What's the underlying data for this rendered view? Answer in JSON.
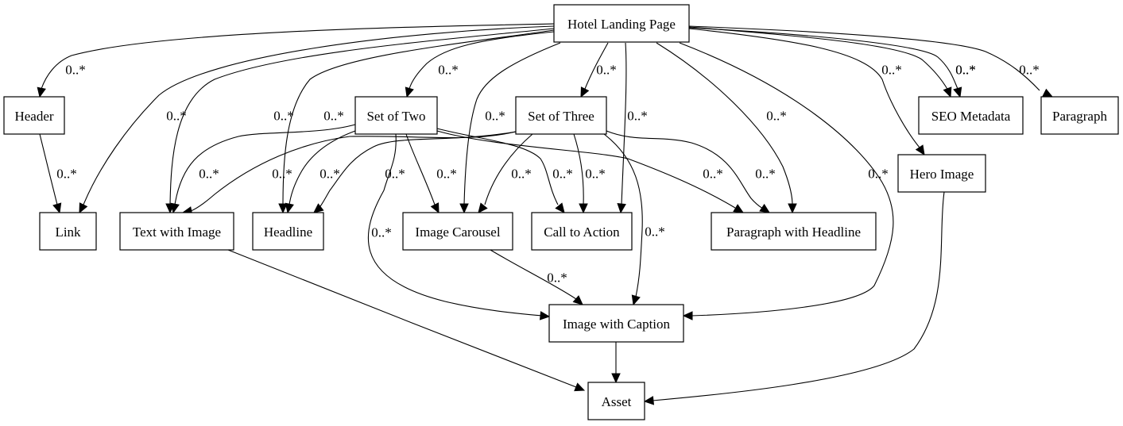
{
  "diagram": {
    "type": "uml-composition-graph",
    "nodes": [
      {
        "id": "hotel",
        "label": "Hotel Landing Page"
      },
      {
        "id": "header",
        "label": "Header"
      },
      {
        "id": "set2",
        "label": "Set of Two"
      },
      {
        "id": "set3",
        "label": "Set of Three"
      },
      {
        "id": "seo",
        "label": "SEO Metadata"
      },
      {
        "id": "paragraph",
        "label": "Paragraph"
      },
      {
        "id": "hero",
        "label": "Hero Image"
      },
      {
        "id": "link",
        "label": "Link"
      },
      {
        "id": "twi",
        "label": "Text with Image"
      },
      {
        "id": "headline",
        "label": "Headline"
      },
      {
        "id": "carousel",
        "label": "Image Carousel"
      },
      {
        "id": "cta",
        "label": "Call to Action"
      },
      {
        "id": "pwh",
        "label": "Paragraph with Headline"
      },
      {
        "id": "iwc",
        "label": "Image with Caption"
      },
      {
        "id": "asset",
        "label": "Asset"
      }
    ],
    "edges": [
      {
        "from": "hotel",
        "to": "header",
        "label": "0..*"
      },
      {
        "from": "hotel",
        "to": "link",
        "label": "0..*"
      },
      {
        "from": "hotel",
        "to": "twi",
        "label": "0..*"
      },
      {
        "from": "hotel",
        "to": "headline",
        "label": "0..*"
      },
      {
        "from": "hotel",
        "to": "set2",
        "label": "0..*"
      },
      {
        "from": "hotel",
        "to": "carousel",
        "label": "0..*"
      },
      {
        "from": "hotel",
        "to": "set3",
        "label": "0..*"
      },
      {
        "from": "hotel",
        "to": "cta",
        "label": "0..*"
      },
      {
        "from": "hotel",
        "to": "pwh",
        "label": "0..*"
      },
      {
        "from": "hotel",
        "to": "iwc",
        "label": "0..*"
      },
      {
        "from": "hotel",
        "to": "hero",
        "label": "0..*"
      },
      {
        "from": "hotel",
        "to": "seo",
        "label": "0..*"
      },
      {
        "from": "hotel",
        "to": "seo",
        "label": "0..*"
      },
      {
        "from": "hotel",
        "to": "paragraph",
        "label": "0..*"
      },
      {
        "from": "header",
        "to": "link",
        "label": "0..*"
      },
      {
        "from": "set2",
        "to": "twi",
        "label": "0..*"
      },
      {
        "from": "set2",
        "to": "headline",
        "label": "0..*"
      },
      {
        "from": "set2",
        "to": "iwc",
        "label": "0..*"
      },
      {
        "from": "set2",
        "to": "carousel",
        "label": "0..*"
      },
      {
        "from": "set2",
        "to": "cta",
        "label": "0..*"
      },
      {
        "from": "set2",
        "to": "pwh",
        "label": "0..*"
      },
      {
        "from": "set3",
        "to": "twi",
        "label": "0..*"
      },
      {
        "from": "set3",
        "to": "headline",
        "label": "0..*"
      },
      {
        "from": "set3",
        "to": "carousel",
        "label": "0..*"
      },
      {
        "from": "set3",
        "to": "cta",
        "label": "0..*"
      },
      {
        "from": "set3",
        "to": "iwc",
        "label": "0..*"
      },
      {
        "from": "set3",
        "to": "pwh",
        "label": "0..*"
      },
      {
        "from": "carousel",
        "to": "iwc",
        "label": "0..*"
      },
      {
        "from": "twi",
        "to": "asset",
        "label": ""
      },
      {
        "from": "iwc",
        "to": "asset",
        "label": ""
      },
      {
        "from": "hero",
        "to": "asset",
        "label": ""
      }
    ]
  }
}
